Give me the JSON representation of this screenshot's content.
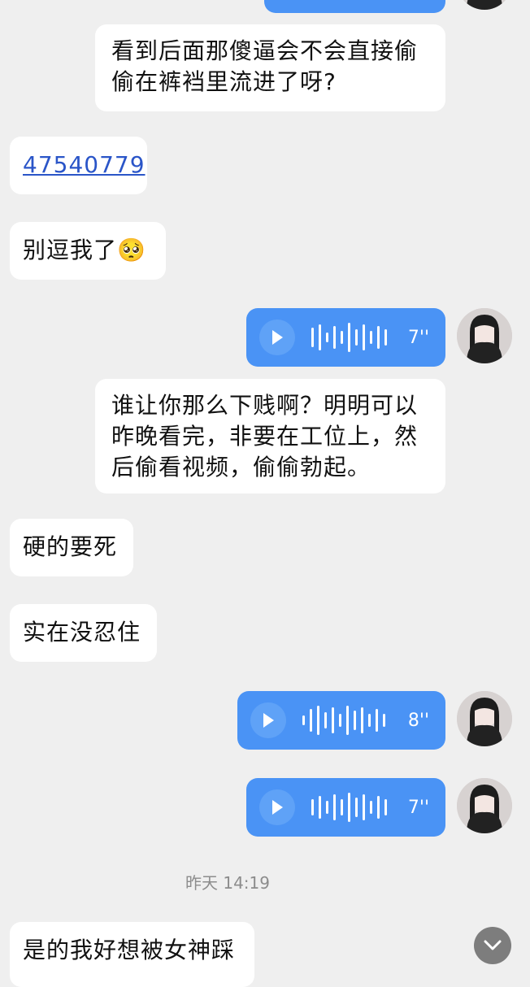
{
  "messages": {
    "m1": "看到后面那傻逼会不会直接偷偷在裤裆里流进了呀?",
    "m1_line1": "看到后面那傻逼会不会直接偷",
    "m1_line2": "偷在裤裆里流进了呀?",
    "m2_link": "47540779",
    "m3": "别逗我了",
    "m3_emoji": "🥺",
    "voice1_duration": "7''",
    "m4_line1": "谁让你那么下贱啊？明明可以",
    "m4_line2": "昨晚看完，非要在工位上，然",
    "m4_line3": "后偷看视频，偷偷勃起。",
    "m5": "硬的要死",
    "m6": "实在没忍住",
    "voice2_duration": "8''",
    "voice3_duration": "7''",
    "timestamp": "昨天 14:19",
    "m7": "是的我好想被女神踩"
  },
  "icons": {
    "play": "play-icon",
    "waveform": "waveform-icon",
    "scroll_down": "chevron-down-icon"
  },
  "colors": {
    "background": "#efefef",
    "bubble_incoming": "#ffffff",
    "bubble_voice": "#4a93f5",
    "link": "#2a55c8"
  }
}
